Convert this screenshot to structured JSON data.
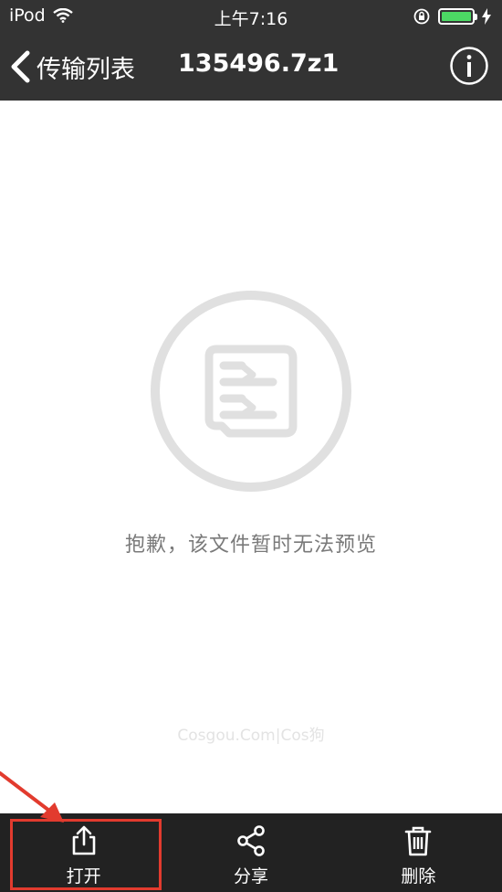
{
  "status_bar": {
    "carrier": "iPod",
    "time": "上午7:16",
    "battery_level": 1.0,
    "battery_color": "#4cd964",
    "icons": [
      "wifi-icon",
      "orientation-lock-icon",
      "charging-bolt-icon"
    ]
  },
  "nav": {
    "back_label": "传输列表",
    "title": "135496.7z1",
    "back_icon": "chevron-left-icon",
    "info_icon": "info-icon"
  },
  "preview": {
    "icon": "document-icon",
    "message": "抱歉，该文件暂时无法预览",
    "watermark": "Cosgou.Com|Cos狗"
  },
  "toolbar": {
    "items": [
      {
        "label": "打开",
        "icon": "share-out-icon"
      },
      {
        "label": "分享",
        "icon": "share-nodes-icon"
      },
      {
        "label": "删除",
        "icon": "trash-icon"
      }
    ]
  },
  "annotation": {
    "highlight_color": "#e23b2e"
  },
  "colors": {
    "header_bg": "#333333",
    "toolbar_bg": "#222222",
    "message_text": "#7a7a7a",
    "icon_gray": "#e0e0e0"
  }
}
